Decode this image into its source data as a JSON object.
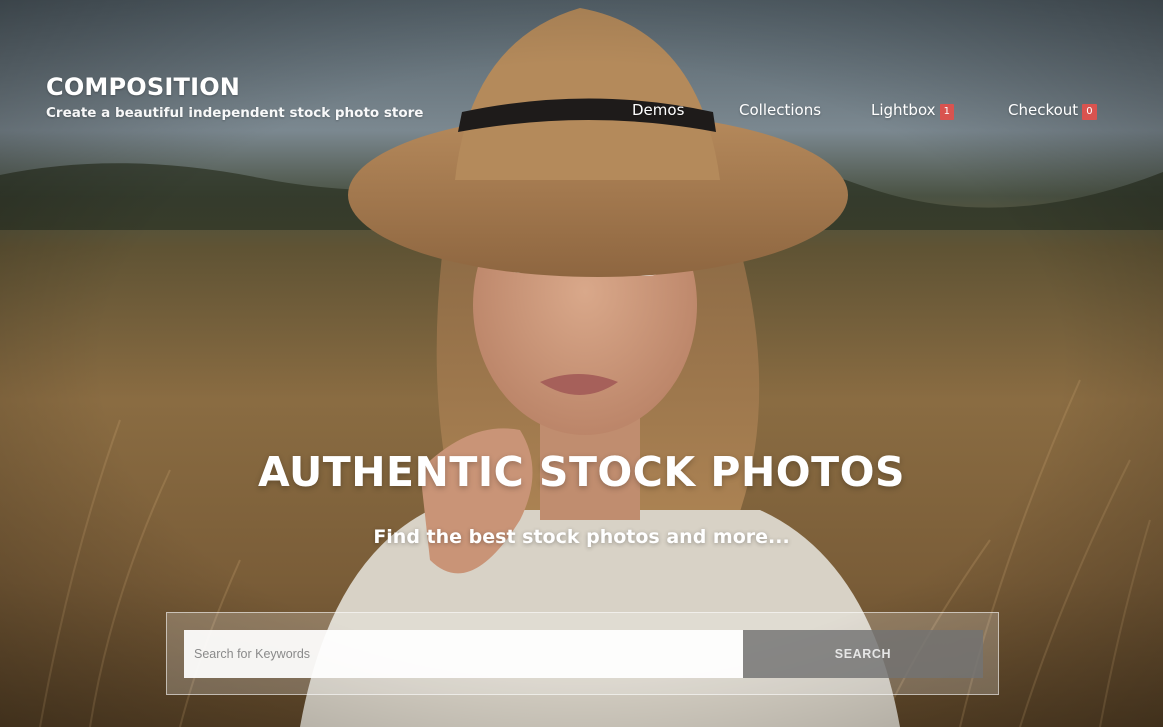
{
  "site": {
    "title": "COMPOSITION",
    "tagline": "Create a beautiful independent stock photo store"
  },
  "nav": {
    "demos": "Demos",
    "collections": "Collections",
    "lightbox": {
      "label": "Lightbox",
      "count": "1"
    },
    "checkout": {
      "label": "Checkout",
      "count": "0"
    }
  },
  "hero": {
    "headline": "AUTHENTIC STOCK PHOTOS",
    "subheadline": "Find the best stock photos and more...",
    "background_image": "woman-in-hat-wheat-field-photo"
  },
  "search": {
    "placeholder": "Search for Keywords",
    "value": "",
    "button_label": "SEARCH"
  },
  "colors": {
    "badge": "#d9534f",
    "text": "#ffffff",
    "search_button": "#737373"
  }
}
